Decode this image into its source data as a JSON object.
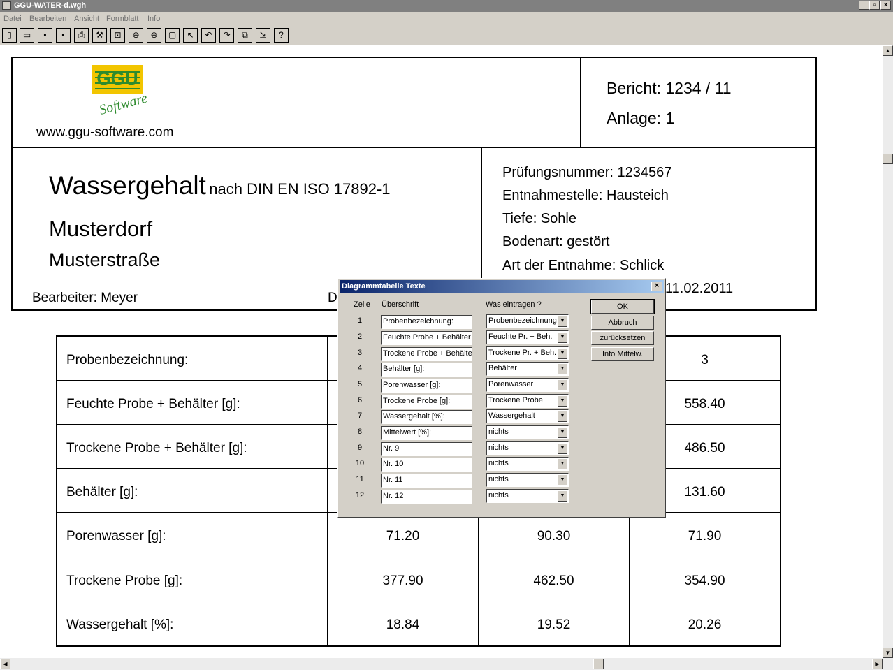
{
  "window": {
    "title": "GGU-WATER-d.wgh"
  },
  "menu": [
    "Datei",
    "Bearbeiten",
    "Ansicht",
    "Formblatt",
    "Info"
  ],
  "toolbar_icons": [
    "new-file-icon",
    "open-folder-icon",
    "save-icon",
    "save-as-icon",
    "print-icon",
    "tool-icon",
    "zoom-page-icon",
    "zoom-out-icon",
    "zoom-in-icon",
    "fit-window-icon",
    "pointer-icon",
    "undo-icon",
    "redo-icon",
    "copy-icon",
    "export-icon",
    "help-icon"
  ],
  "toolbar_help": "?",
  "report": {
    "logo_text": "GGU",
    "logo_sub": "Software",
    "website": "www.ggu-software.com",
    "bericht_label": "Bericht:",
    "bericht": "1234 / 11",
    "anlage_label": "Anlage:",
    "anlage": "1",
    "title": "Wassergehalt",
    "title_norm": "nach DIN EN ISO 17892-1",
    "place": "Musterdorf",
    "street": "Musterstraße",
    "bearbeiter_label": "Bearbeiter:",
    "bearbeiter": "Meyer",
    "datum_partial": "D",
    "info": [
      {
        "label": "Prüfungsnummer:",
        "value": "1234567"
      },
      {
        "label": "Entnahmestelle:",
        "value": "Hausteich"
      },
      {
        "label": "Tiefe:",
        "value": "Sohle"
      },
      {
        "label": "Bodenart:",
        "value": "gestört"
      },
      {
        "label": "Art der Entnahme:",
        "value": "Schlick"
      }
    ],
    "date_visible": "11.02.2011"
  },
  "table": {
    "rows": [
      {
        "label": "Probenbezeichnung:",
        "c1": "",
        "c2": "",
        "c3": "3"
      },
      {
        "label": "Feuchte Probe + Behälter [g]:",
        "c1": "",
        "c2": "",
        "c3": "558.40"
      },
      {
        "label": "Trockene Probe + Behälter [g]:",
        "c1": "",
        "c2": "",
        "c3": "486.50"
      },
      {
        "label": "Behälter [g]:",
        "c1": "",
        "c2": "",
        "c3": "131.60"
      },
      {
        "label": "Porenwasser [g]:",
        "c1": "71.20",
        "c2": "90.30",
        "c3": "71.90"
      },
      {
        "label": "Trockene Probe [g]:",
        "c1": "377.90",
        "c2": "462.50",
        "c3": "354.90"
      },
      {
        "label": "Wassergehalt [%]:",
        "c1": "18.84",
        "c2": "19.52",
        "c3": "20.26"
      }
    ]
  },
  "dialog": {
    "title": "Diagrammtabelle Texte",
    "close": "×",
    "col_zeile": "Zeile",
    "col_ueberschrift": "Überschrift",
    "col_eintragen": "Was eintragen ?",
    "rows": [
      {
        "n": "1",
        "text": "Probenbezeichnung:",
        "sel": "Probenbezeichnung"
      },
      {
        "n": "2",
        "text": "Feuchte Probe + Behälter [",
        "sel": "Feuchte Pr. + Beh."
      },
      {
        "n": "3",
        "text": "Trockene Probe + Behälte",
        "sel": "Trockene Pr. + Beh."
      },
      {
        "n": "4",
        "text": "Behälter [g]:",
        "sel": "Behälter"
      },
      {
        "n": "5",
        "text": "Porenwasser [g]:",
        "sel": "Porenwasser"
      },
      {
        "n": "6",
        "text": "Trockene Probe [g]:",
        "sel": "Trockene Probe"
      },
      {
        "n": "7",
        "text": "Wassergehalt [%]:",
        "sel": "Wassergehalt"
      },
      {
        "n": "8",
        "text": "Mittelwert [%]:",
        "sel": "nichts"
      },
      {
        "n": "9",
        "text": "Nr. 9",
        "sel": "nichts"
      },
      {
        "n": "10",
        "text": "Nr. 10",
        "sel": "nichts"
      },
      {
        "n": "11",
        "text": "Nr. 11",
        "sel": "nichts"
      },
      {
        "n": "12",
        "text": "Nr. 12",
        "sel": "nichts"
      }
    ],
    "buttons": {
      "ok": "OK",
      "cancel": "Abbruch",
      "reset": "zurücksetzen",
      "info": "Info Mittelw."
    }
  }
}
